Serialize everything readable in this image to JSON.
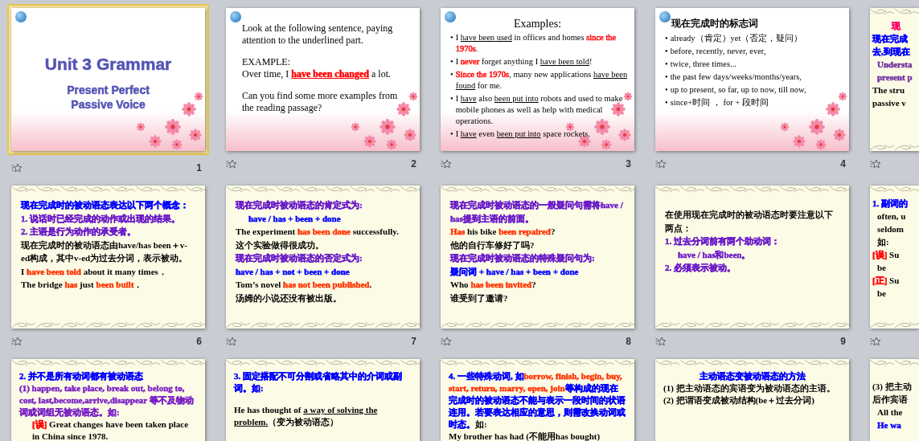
{
  "slides": [
    {
      "number": "1",
      "selected": true,
      "kind": "floral",
      "lines": [
        {
          "kind": "heading",
          "runs": [
            {
              "text": "Unit  3 Grammar",
              "color": "#5555b5"
            }
          ]
        },
        {
          "kind": "subheading",
          "runs": [
            {
              "text": "Present Perfect Passive Voice",
              "color": "#5555b5"
            }
          ]
        }
      ]
    },
    {
      "number": "2",
      "selected": false,
      "kind": "floral",
      "lines": [
        {
          "kind": "text",
          "runs": [
            {
              "text": "Look at the following sentence, paying attention to the underlined part."
            }
          ]
        },
        {
          "kind": "para",
          "runs": [
            {
              "text": "EXAMPLE:"
            }
          ]
        },
        {
          "kind": "text",
          "runs": [
            {
              "text": "Over time, I "
            },
            {
              "text": "have been changed",
              "color": "#ff0000",
              "underline": true,
              "strong": true
            },
            {
              "text": " a lot."
            }
          ]
        },
        {
          "kind": "para",
          "runs": [
            {
              "text": "Can you find some more examples from the reading passage?"
            }
          ]
        }
      ]
    },
    {
      "number": "3",
      "selected": false,
      "kind": "floral",
      "lines": [
        {
          "kind": "title",
          "runs": [
            {
              "text": "Examples:"
            }
          ]
        },
        {
          "kind": "bullet",
          "bullet": "•",
          "runs": [
            {
              "text": "I "
            },
            {
              "text": "have been used",
              "underline": true
            },
            {
              "text": " in offices and homes "
            },
            {
              "text": "since the 1970s",
              "color": "#ff0000"
            },
            {
              "text": "."
            }
          ]
        },
        {
          "kind": "bullet",
          "bullet": "•",
          "runs": [
            {
              "text": "I "
            },
            {
              "text": "never",
              "color": "#ff0000"
            },
            {
              "text": " forget anything I "
            },
            {
              "text": "have been told",
              "underline": true
            },
            {
              "text": "!"
            }
          ]
        },
        {
          "kind": "bullet",
          "bullet": "•",
          "runs": [
            {
              "text": "Since the 1970s",
              "color": "#ff0000"
            },
            {
              "text": ", many new applications "
            },
            {
              "text": "have been found",
              "underline": true
            },
            {
              "text": " for me."
            }
          ]
        },
        {
          "kind": "bullet",
          "bullet": "•",
          "runs": [
            {
              "text": "I "
            },
            {
              "text": "have",
              "underline": true
            },
            {
              "text": " also "
            },
            {
              "text": "been put into",
              "underline": true
            },
            {
              "text": " robots and used to make mobile phones as well as help with medical operations."
            }
          ]
        },
        {
          "kind": "bullet",
          "bullet": "•",
          "runs": [
            {
              "text": "I "
            },
            {
              "text": "have",
              "underline": true
            },
            {
              "text": " even "
            },
            {
              "text": "been put into",
              "underline": true
            },
            {
              "text": " space rockets."
            }
          ]
        }
      ]
    },
    {
      "number": "4",
      "selected": false,
      "kind": "floral",
      "lines": [
        {
          "kind": "cn-title",
          "runs": [
            {
              "text": "现在完成时的标志词"
            }
          ]
        },
        {
          "kind": "bullet",
          "bullet": "•",
          "runs": [
            {
              "text": "already（肯定）yet（否定，疑问）"
            }
          ]
        },
        {
          "kind": "bullet",
          "bullet": "•",
          "runs": [
            {
              "text": "before, recently, never, ever,"
            }
          ]
        },
        {
          "kind": "bullet",
          "bullet": "•",
          "runs": [
            {
              "text": "twice, three times..."
            }
          ]
        },
        {
          "kind": "bullet",
          "bullet": "•",
          "runs": [
            {
              "text": "the past few days/weeks/months/years,"
            }
          ]
        },
        {
          "kind": "bullet",
          "bullet": "•",
          "runs": [
            {
              "text": "up to present, so far, up to now, till now,"
            }
          ]
        },
        {
          "kind": "bullet",
          "bullet": "•",
          "runs": [
            {
              "text": "since+时间 ， for + 段时间"
            }
          ]
        }
      ]
    },
    {
      "selected": false,
      "kind": "ornate",
      "lines": [
        {
          "kind": "center",
          "runs": [
            {
              "text": "现",
              "color": "#ff0066"
            }
          ]
        },
        {
          "kind": "text",
          "runs": [
            {
              "text": "现在完成",
              "color": "#0000ff"
            }
          ]
        },
        {
          "kind": "text",
          "runs": [
            {
              "text": "去,到现在",
              "color": "#0000ff"
            }
          ]
        },
        {
          "kind": "indent",
          "runs": [
            {
              "text": "Understa",
              "color": "#7030a0"
            }
          ]
        },
        {
          "kind": "indent",
          "runs": [
            {
              "text": "present p",
              "color": "#7030a0"
            }
          ]
        },
        {
          "kind": "text",
          "runs": [
            {
              "text": "The stru"
            }
          ]
        },
        {
          "kind": "text",
          "runs": [
            {
              "text": "passive v"
            }
          ]
        }
      ]
    },
    {
      "number": "6",
      "selected": false,
      "kind": "ornate",
      "lines": [
        {
          "kind": "text",
          "runs": [
            {
              "text": "现在完成时的被动语态表达以下两个概念：",
              "color": "#0000ff"
            }
          ]
        },
        {
          "kind": "text",
          "runs": [
            {
              "text": "1. 说话时已经完成的动作或出现的结果。",
              "color": "#6a1bc9"
            }
          ]
        },
        {
          "kind": "text",
          "runs": [
            {
              "text": "2. 主语是行为动作的承受者。",
              "color": "#6a1bc9"
            }
          ]
        },
        {
          "kind": "text",
          "runs": [
            {
              "text": "现在完成时的被动语态由have/has been＋v-ed构成，其中v-ed为过去分词，表示被动。"
            }
          ]
        },
        {
          "kind": "text",
          "runs": [
            {
              "text": "I "
            },
            {
              "text": "have been told",
              "color": "#ff3300"
            },
            {
              "text": " about it many times．"
            }
          ]
        },
        {
          "kind": "text",
          "runs": [
            {
              "text": "The bridge "
            },
            {
              "text": "has",
              "color": "#ff3300"
            },
            {
              "text": " just "
            },
            {
              "text": "been built",
              "color": "#ff3300"
            },
            {
              "text": "．"
            }
          ]
        }
      ]
    },
    {
      "number": "7",
      "selected": false,
      "kind": "ornate",
      "lines": [
        {
          "kind": "text",
          "runs": [
            {
              "text": "现在完成时被动语态的肯定式为:",
              "color": "#6a1bc9"
            }
          ]
        },
        {
          "kind": "indent",
          "runs": [
            {
              "text": "have / has + been + done",
              "color": "#0000ff"
            }
          ]
        },
        {
          "kind": "text",
          "runs": [
            {
              "text": "The experiment "
            },
            {
              "text": "has been done",
              "color": "#ff3300"
            },
            {
              "text": " successfully."
            }
          ]
        },
        {
          "kind": "text",
          "runs": [
            {
              "text": "这个实验做得很成功。"
            }
          ]
        },
        {
          "kind": "text",
          "runs": [
            {
              "text": "现在完成时被动语态的否定式为:",
              "color": "#6a1bc9"
            }
          ]
        },
        {
          "kind": "text",
          "runs": [
            {
              "text": "have / has + not + been + done",
              "color": "#0000ff"
            }
          ]
        },
        {
          "kind": "text",
          "runs": [
            {
              "text": "Tom’s novel "
            },
            {
              "text": "has not been published",
              "color": "#ff3300"
            },
            {
              "text": "."
            }
          ]
        },
        {
          "kind": "text",
          "runs": [
            {
              "text": "汤姆的小说还没有被出版。"
            }
          ]
        }
      ]
    },
    {
      "number": "8",
      "selected": false,
      "kind": "ornate",
      "lines": [
        {
          "kind": "text",
          "runs": [
            {
              "text": "现在完成时被动语态的一般疑问句需将have / has提到主语的前面。",
              "color": "#6a1bc9"
            }
          ]
        },
        {
          "kind": "text",
          "runs": [
            {
              "text": "Has",
              "color": "#ff3300"
            },
            {
              "text": " his bike "
            },
            {
              "text": "been repaired",
              "color": "#ff3300"
            },
            {
              "text": "?"
            }
          ]
        },
        {
          "kind": "text",
          "runs": [
            {
              "text": "他的自行车修好了吗?"
            }
          ]
        },
        {
          "kind": "text",
          "runs": [
            {
              "text": "现在完成时被动语态的特殊疑问句为:",
              "color": "#6a1bc9"
            }
          ]
        },
        {
          "kind": "text",
          "runs": [
            {
              "text": "疑问词 + have / has + been + done",
              "color": "#0000ff"
            }
          ]
        },
        {
          "kind": "text",
          "runs": [
            {
              "text": "Who "
            },
            {
              "text": "has been invited",
              "color": "#ff3300"
            },
            {
              "text": "?"
            }
          ]
        },
        {
          "kind": "text",
          "runs": [
            {
              "text": "谁受到了邀请?"
            }
          ]
        }
      ]
    },
    {
      "number": "9",
      "selected": false,
      "kind": "ornate",
      "lines": [
        {
          "kind": "para",
          "runs": [
            {
              "text": "在使用现在完成时的被动语态时要注意以下两点："
            }
          ]
        },
        {
          "kind": "text",
          "runs": [
            {
              "text": "1. 过去分词前有两个助动词：",
              "color": "#6a1bc9"
            }
          ]
        },
        {
          "kind": "indent",
          "runs": [
            {
              "text": "have / has和been。",
              "color": "#6a1bc9"
            }
          ]
        },
        {
          "kind": "text",
          "runs": [
            {
              "text": "2. 必须表示被动。",
              "color": "#6a1bc9"
            }
          ]
        }
      ]
    },
    {
      "selected": false,
      "kind": "ornate",
      "lines": [
        {
          "kind": "text",
          "runs": [
            {
              "text": "1. 副词的",
              "color": "#0000ff"
            }
          ]
        },
        {
          "kind": "indent",
          "runs": [
            {
              "text": "often, u"
            }
          ]
        },
        {
          "kind": "indent",
          "runs": [
            {
              "text": "seldom"
            }
          ]
        },
        {
          "kind": "indent",
          "runs": [
            {
              "text": "如:"
            }
          ]
        },
        {
          "kind": "text",
          "runs": [
            {
              "text": "[误]",
              "color": "#ff0000"
            },
            {
              "text": " Su"
            }
          ]
        },
        {
          "kind": "indent",
          "runs": [
            {
              "text": "be"
            }
          ]
        },
        {
          "kind": "text",
          "runs": [
            {
              "text": "[正]",
              "color": "#ff0000"
            },
            {
              "text": " Su"
            }
          ]
        },
        {
          "kind": "indent",
          "runs": [
            {
              "text": "be"
            }
          ]
        }
      ]
    },
    {
      "selected": false,
      "kind": "ornate",
      "lines": [
        {
          "kind": "text",
          "runs": [
            {
              "text": "2. 并不是所有动词都有被动语态",
              "color": "#0000ff"
            }
          ]
        },
        {
          "kind": "text",
          "runs": [
            {
              "text": "(1) happen, take place, break out, belong to, cost, last,become,arrive,disappear 等不及物动词或词组无被动语态。如:",
              "color": "#7a1fc4"
            }
          ]
        },
        {
          "kind": "indent",
          "runs": [
            {
              "text": "[误]",
              "color": "#ff0000"
            },
            {
              "text": " Great changes have been taken place in China since 1978."
            }
          ]
        }
      ]
    },
    {
      "selected": false,
      "kind": "ornate",
      "lines": [
        {
          "kind": "text",
          "runs": [
            {
              "text": "3. 固定搭配不可分割或省略其中的介词或副词。如:",
              "color": "#0000ff"
            }
          ]
        },
        {
          "kind": "para",
          "runs": [
            {
              "text": "He has thought of "
            },
            {
              "text": "a way of solving the problem.",
              "underline": true
            },
            {
              "text": "（变为被动语态）"
            }
          ]
        }
      ]
    },
    {
      "selected": false,
      "kind": "ornate",
      "lines": [
        {
          "kind": "text",
          "runs": [
            {
              "text": "4. 一些特殊动词, 如",
              "color": "#0000ff"
            },
            {
              "text": "borrow, finish, begin, buy, start, return, marry, open, join",
              "color": "#ff3300"
            },
            {
              "text": "等构成的现在完成时的被动语态不能与表示一段时间的状语连用。若要表达相应的意思，则需改换动词或时态。",
              "color": "#0000ff"
            },
            {
              "text": "如:"
            }
          ]
        },
        {
          "kind": "text",
          "runs": [
            {
              "text": "My brother has had (不能用has bought)"
            }
          ]
        }
      ]
    },
    {
      "selected": false,
      "kind": "ornate",
      "lines": [
        {
          "kind": "center",
          "runs": [
            {
              "text": "主动语态变被动语态的方法",
              "color": "#0000ff"
            }
          ]
        },
        {
          "kind": "text",
          "runs": [
            {
              "text": "(1) 把主动语态的宾语变为被动语态的主语。"
            }
          ]
        },
        {
          "kind": "text",
          "runs": [
            {
              "text": "(2) 把谓语变成被动结构(be＋过去分词)"
            }
          ]
        }
      ]
    },
    {
      "selected": false,
      "kind": "ornate",
      "lines": [
        {
          "kind": "para",
          "runs": [
            {
              "text": "(3) 把主动"
            }
          ]
        },
        {
          "kind": "text",
          "runs": [
            {
              "text": "后作宾语"
            }
          ]
        },
        {
          "kind": "indent",
          "runs": [
            {
              "text": "All the"
            }
          ]
        },
        {
          "kind": "indent",
          "runs": [
            {
              "text": "He wa",
              "color": "#0000ff"
            }
          ]
        }
      ]
    }
  ]
}
